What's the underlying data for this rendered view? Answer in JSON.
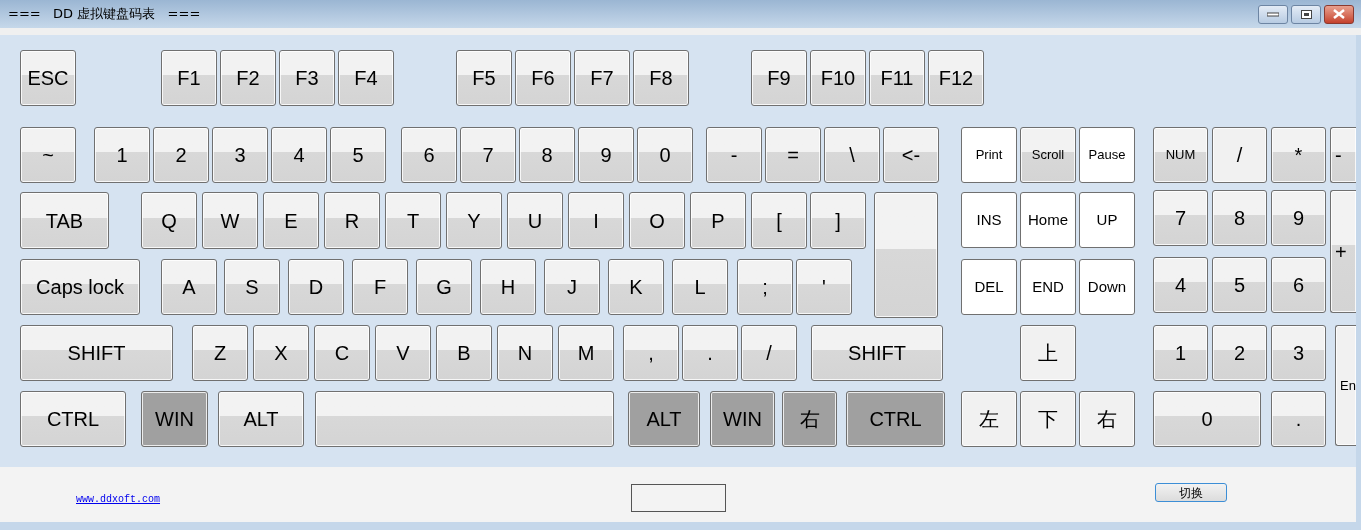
{
  "window": {
    "title": "===   DD 虚拟键盘码表   ==="
  },
  "keyboard": {
    "keys": [
      {
        "label": "ESC",
        "kind": "normal"
      },
      {
        "label": "F1",
        "kind": "normal"
      },
      {
        "label": "F2",
        "kind": "normal"
      },
      {
        "label": "F3",
        "kind": "normal"
      },
      {
        "label": "F4",
        "kind": "normal"
      },
      {
        "label": "F5",
        "kind": "normal"
      },
      {
        "label": "F6",
        "kind": "normal"
      },
      {
        "label": "F7",
        "kind": "normal"
      },
      {
        "label": "F8",
        "kind": "normal"
      },
      {
        "label": "F9",
        "kind": "normal"
      },
      {
        "label": "F10",
        "kind": "normal"
      },
      {
        "label": "F11",
        "kind": "normal"
      },
      {
        "label": "F12",
        "kind": "normal"
      },
      {
        "label": "~",
        "kind": "normal"
      },
      {
        "label": "1",
        "kind": "normal"
      },
      {
        "label": "2",
        "kind": "normal"
      },
      {
        "label": "3",
        "kind": "normal"
      },
      {
        "label": "4",
        "kind": "normal"
      },
      {
        "label": "5",
        "kind": "normal"
      },
      {
        "label": "6",
        "kind": "normal"
      },
      {
        "label": "7",
        "kind": "normal"
      },
      {
        "label": "8",
        "kind": "normal"
      },
      {
        "label": "9",
        "kind": "normal"
      },
      {
        "label": "0",
        "kind": "normal"
      },
      {
        "label": "-",
        "kind": "normal"
      },
      {
        "label": "=",
        "kind": "normal"
      },
      {
        "label": "\\",
        "kind": "normal"
      },
      {
        "label": "<-",
        "kind": "normal"
      },
      {
        "label": "Print",
        "kind": "white"
      },
      {
        "label": "Scroll",
        "kind": "normal"
      },
      {
        "label": "Pause",
        "kind": "white"
      },
      {
        "label": "NUM",
        "kind": "normal"
      },
      {
        "label": "/",
        "kind": "light"
      },
      {
        "label": "*",
        "kind": "normal"
      },
      {
        "label": "-",
        "kind": "normal"
      },
      {
        "label": "TAB",
        "kind": "normal"
      },
      {
        "label": "Q",
        "kind": "normal"
      },
      {
        "label": "W",
        "kind": "normal"
      },
      {
        "label": "E",
        "kind": "normal"
      },
      {
        "label": "R",
        "kind": "normal"
      },
      {
        "label": "T",
        "kind": "normal"
      },
      {
        "label": "Y",
        "kind": "normal"
      },
      {
        "label": "U",
        "kind": "normal"
      },
      {
        "label": "I",
        "kind": "normal"
      },
      {
        "label": "O",
        "kind": "normal"
      },
      {
        "label": "P",
        "kind": "normal"
      },
      {
        "label": "[",
        "kind": "normal"
      },
      {
        "label": "]",
        "kind": "normal"
      },
      {
        "kind": "normal"
      },
      {
        "label": "INS",
        "kind": "white"
      },
      {
        "label": "Home",
        "kind": "white"
      },
      {
        "label": "UP",
        "kind": "white"
      },
      {
        "label": "7",
        "kind": "normal"
      },
      {
        "label": "8",
        "kind": "normal"
      },
      {
        "label": "9",
        "kind": "normal"
      },
      {
        "label": "+",
        "kind": "normal"
      },
      {
        "label": "Caps lock",
        "kind": "normal"
      },
      {
        "label": "A",
        "kind": "normal"
      },
      {
        "label": "S",
        "kind": "normal"
      },
      {
        "label": "D",
        "kind": "normal"
      },
      {
        "label": "F",
        "kind": "normal"
      },
      {
        "label": "G",
        "kind": "normal"
      },
      {
        "label": "H",
        "kind": "normal"
      },
      {
        "label": "J",
        "kind": "normal"
      },
      {
        "label": "K",
        "kind": "normal"
      },
      {
        "label": "L",
        "kind": "normal"
      },
      {
        "label": ";",
        "kind": "normal"
      },
      {
        "label": "'",
        "kind": "normal"
      },
      {
        "label": "DEL",
        "kind": "white"
      },
      {
        "label": "END",
        "kind": "white"
      },
      {
        "label": "Down",
        "kind": "white"
      },
      {
        "label": "4",
        "kind": "normal"
      },
      {
        "label": "5",
        "kind": "normal"
      },
      {
        "label": "6",
        "kind": "normal"
      },
      {
        "label": "SHIFT",
        "kind": "normal"
      },
      {
        "label": "Z",
        "kind": "normal"
      },
      {
        "label": "X",
        "kind": "normal"
      },
      {
        "label": "C",
        "kind": "normal"
      },
      {
        "label": "V",
        "kind": "normal"
      },
      {
        "label": "B",
        "kind": "normal"
      },
      {
        "label": "N",
        "kind": "normal"
      },
      {
        "label": "M",
        "kind": "normal"
      },
      {
        "label": ",",
        "kind": "normal"
      },
      {
        "label": ".",
        "kind": "normal"
      },
      {
        "label": "/",
        "kind": "normal"
      },
      {
        "label": "SHIFT",
        "kind": "normal"
      },
      {
        "label": "上",
        "kind": "light"
      },
      {
        "label": "1",
        "kind": "normal"
      },
      {
        "label": "2",
        "kind": "normal"
      },
      {
        "label": "3",
        "kind": "normal"
      },
      {
        "label": "En",
        "kind": "light"
      },
      {
        "label": "CTRL",
        "kind": "normal"
      },
      {
        "label": "WIN",
        "kind": "dark"
      },
      {
        "label": "ALT",
        "kind": "normal"
      },
      {
        "kind": "normal"
      },
      {
        "label": "ALT",
        "kind": "dark"
      },
      {
        "label": "WIN",
        "kind": "dark"
      },
      {
        "label": "右",
        "kind": "dark"
      },
      {
        "label": "CTRL",
        "kind": "dark"
      },
      {
        "label": "左",
        "kind": "light"
      },
      {
        "label": "下",
        "kind": "light"
      },
      {
        "label": "右",
        "kind": "light"
      },
      {
        "label": "0",
        "kind": "normal"
      },
      {
        "label": ".",
        "kind": "normal"
      }
    ]
  },
  "footer": {
    "link": "www.ddxoft.com",
    "button": "切换"
  }
}
